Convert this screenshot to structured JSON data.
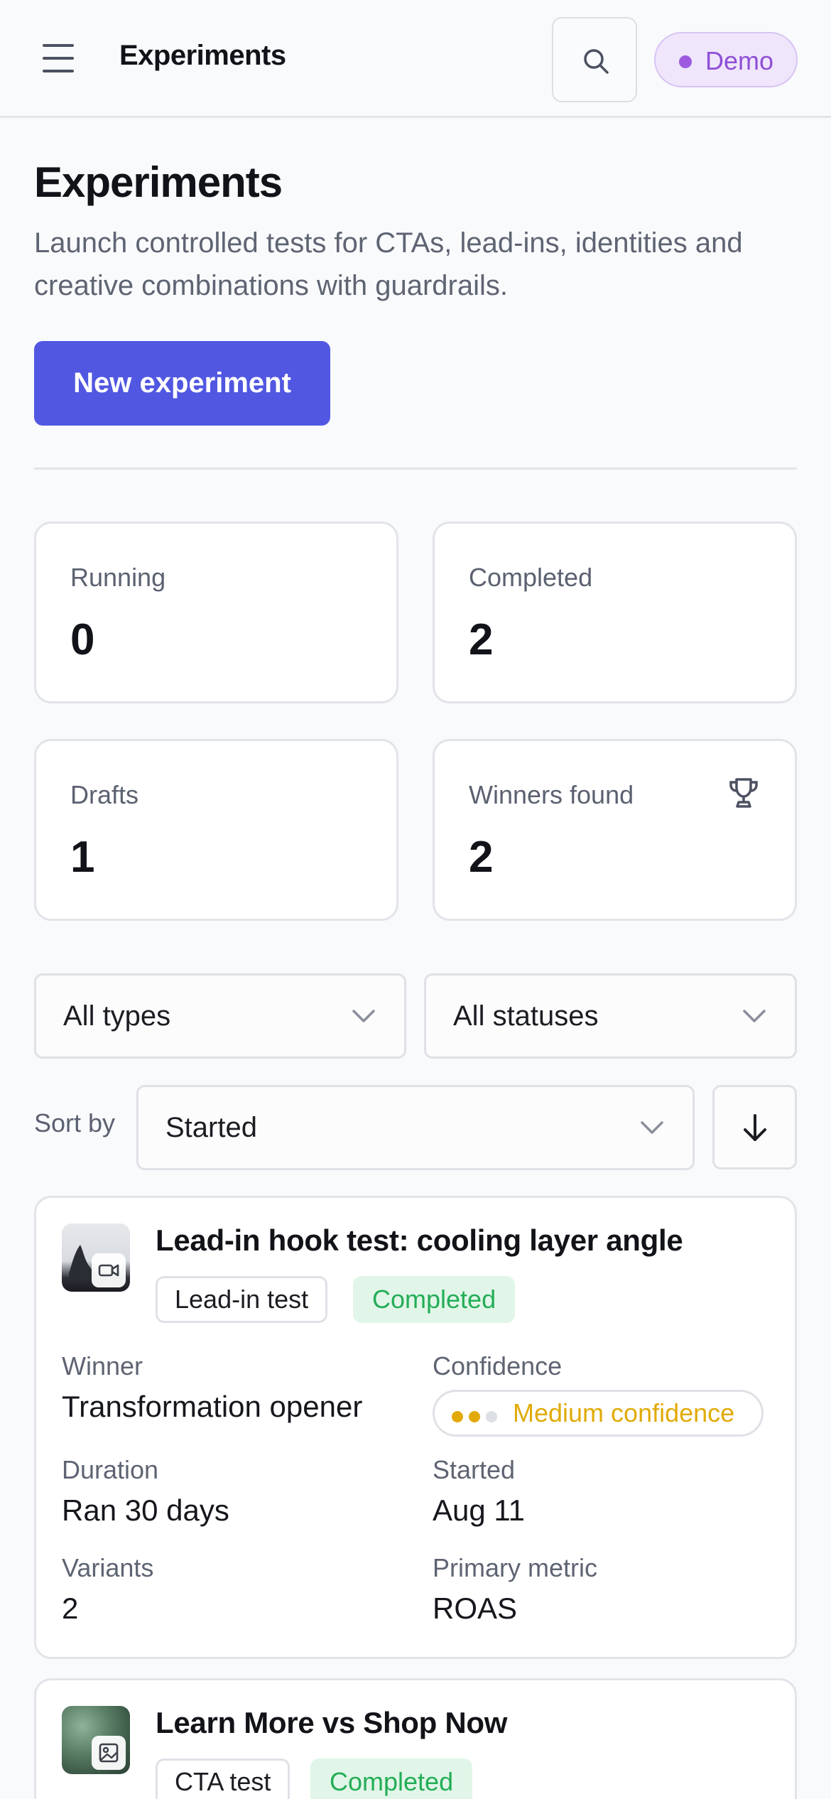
{
  "header": {
    "title": "Experiments",
    "badge": "Demo"
  },
  "page": {
    "title": "Experiments",
    "description": "Launch controlled tests for CTAs, lead-ins, identities and creative combinations with guardrails.",
    "new_button": "New experiment"
  },
  "stats": [
    {
      "label": "Running",
      "value": "0"
    },
    {
      "label": "Completed",
      "value": "2"
    },
    {
      "label": "Drafts",
      "value": "1"
    },
    {
      "label": "Winners found",
      "value": "2",
      "icon": "trophy-icon"
    }
  ],
  "filters": {
    "type": "All types",
    "status": "All statuses",
    "sort_label": "Sort by",
    "sort_value": "Started",
    "sort_direction": "descending"
  },
  "experiments": [
    {
      "title": "Lead-in hook test: cooling layer angle",
      "type": "Lead-in test",
      "status": "Completed",
      "media_icon": "video-icon",
      "winner_label": "Winner",
      "winner": "Transformation opener",
      "confidence_label": "Confidence",
      "confidence": "Medium confidence",
      "confidence_level": 2,
      "confidence_max": 3,
      "duration_label": "Duration",
      "duration": "Ran 30 days",
      "started_label": "Started",
      "started": "Aug 11",
      "variants_label": "Variants",
      "variants": "2",
      "metric_label": "Primary metric",
      "metric": "ROAS"
    },
    {
      "title": "Learn More vs Shop Now",
      "type": "CTA test",
      "status": "Completed",
      "media_icon": "image-icon"
    }
  ],
  "colors": {
    "accent": "#5157e1",
    "success": "#24ad57",
    "warning": "#e1aa08",
    "demo": "#8f4fd6"
  }
}
